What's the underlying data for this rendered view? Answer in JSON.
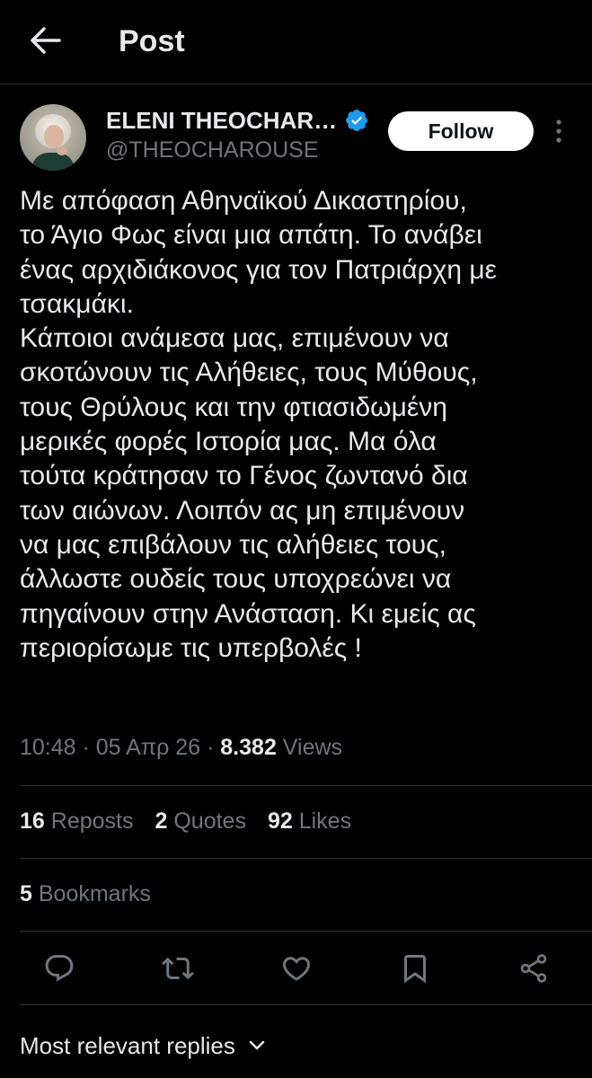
{
  "header": {
    "title": "Post"
  },
  "author": {
    "name": "ELENI THEOCHAR…",
    "handle": "@THEOCHAROUSE",
    "verified": true,
    "verified_color": "#1d9bf0"
  },
  "follow_button": {
    "label": "Follow"
  },
  "post": {
    "lines": [
      "Με απόφαση Αθηναϊκού Δικαστηρίου,",
      "το Άγιο Φως είναι μια απάτη. Το ανάβει",
      "ένας αρχιδιάκονος για τον Πατριάρχη με",
      "τσακμάκι.",
      "Κάποιοι ανάμεσα μας, επιμένουν να",
      "σκοτώνουν τις Αλήθειες, τους Μύθους,",
      "τους Θρύλους και την φτιασιδωμένη",
      "μερικές φορές Ιστορία μας. Μα όλα",
      "τούτα κράτησαν το Γένος ζωντανό δια",
      "των αιώνων. Λοιπόν ας μη επιμένουν",
      "να μας επιβάλουν τις αλήθειες τους,",
      "άλλωστε ουδείς τους υποχρεώνει να",
      "πηγαίνουν στην Ανάσταση. Κι εμείς ας",
      "περιορίσωμε τις υπερβολές !"
    ]
  },
  "meta": {
    "time": "10:48",
    "date": "05 Απρ 26",
    "views_count": "8.382",
    "views_label": "Views"
  },
  "stats": {
    "reposts_count": "16",
    "reposts_label": "Reposts",
    "quotes_count": "2",
    "quotes_label": "Quotes",
    "likes_count": "92",
    "likes_label": "Likes",
    "bookmarks_count": "5",
    "bookmarks_label": "Bookmarks"
  },
  "replies": {
    "sort_label": "Most relevant replies"
  },
  "icons": {
    "back": "arrow-left-icon",
    "verified": "verified-badge-icon",
    "more": "more-vertical-icon",
    "reply": "reply-icon",
    "repost": "repost-icon",
    "like": "heart-icon",
    "bookmark": "bookmark-icon",
    "share": "share-icon",
    "chevron": "chevron-down-icon"
  },
  "colors": {
    "background": "#000000",
    "text_primary": "#e7e9ea",
    "text_secondary": "#71767b",
    "divider": "#2f3336",
    "accent": "#1d9bf0"
  }
}
